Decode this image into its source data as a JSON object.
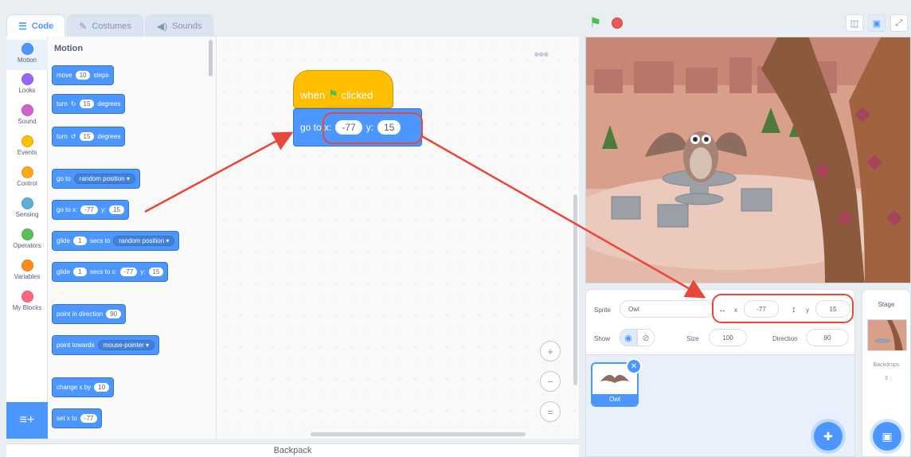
{
  "tabs": [
    {
      "label": "Code",
      "icon": "code-icon",
      "active": true
    },
    {
      "label": "Costumes",
      "icon": "brush-icon",
      "active": false
    },
    {
      "label": "Sounds",
      "icon": "speaker-icon",
      "active": false
    }
  ],
  "categories": [
    {
      "label": "Motion",
      "color": "#4c97ff"
    },
    {
      "label": "Looks",
      "color": "#9966ff"
    },
    {
      "label": "Sound",
      "color": "#cf63cf"
    },
    {
      "label": "Events",
      "color": "#ffbf00"
    },
    {
      "label": "Control",
      "color": "#ffab19"
    },
    {
      "label": "Sensing",
      "color": "#5cb1d6"
    },
    {
      "label": "Operators",
      "color": "#59c059"
    },
    {
      "label": "Variables",
      "color": "#ff8c1a"
    },
    {
      "label": "My Blocks",
      "color": "#ff6680"
    }
  ],
  "palette": {
    "title": "Motion",
    "move": {
      "a": "move",
      "v": "10",
      "b": "steps"
    },
    "turn_cw": {
      "a": "turn",
      "icon": "↻",
      "v": "15",
      "b": "degrees"
    },
    "turn_ccw": {
      "a": "turn",
      "icon": "↺",
      "v": "15",
      "b": "degrees"
    },
    "goto_random": {
      "a": "go to",
      "dd": "random position ▾"
    },
    "goto_xy": {
      "a": "go to x:",
      "x": "-77",
      "b": "y:",
      "y": "15"
    },
    "glide_random": {
      "a": "glide",
      "v": "1",
      "b": "secs to",
      "dd": "random position ▾"
    },
    "glide_xy": {
      "a": "glide",
      "v": "1",
      "b": "secs to x:",
      "x": "-77",
      "c": "y:",
      "y": "15"
    },
    "point_dir": {
      "a": "point in direction",
      "v": "90"
    },
    "point_towards": {
      "a": "point towards",
      "dd": "mouse-pointer ▾"
    },
    "change_x": {
      "a": "change x by",
      "v": "10"
    },
    "set_x": {
      "a": "set x to",
      "v": "-77"
    }
  },
  "script": {
    "hat_when": "when",
    "hat_clicked": "clicked",
    "goto_label": "go to x:",
    "x": "-77",
    "y_label": "y:",
    "y": "15"
  },
  "zoom": {
    "in": "+",
    "out": "−",
    "reset": "="
  },
  "backpack": "Backpack",
  "sprite_info": {
    "sprite_label": "Sprite",
    "sprite_name": "Owl",
    "x_label": "x",
    "x": "-77",
    "y_label": "y",
    "y": "15",
    "show_label": "Show",
    "size_label": "Size",
    "size": "100",
    "direction_label": "Direction",
    "direction": "90"
  },
  "sprites": [
    {
      "name": "Owl"
    }
  ],
  "stage_panel": {
    "title": "Stage",
    "backdrops_label": "Backdrops",
    "backdrops_count": "3"
  },
  "colors": {
    "motion": "#4c97ff",
    "events": "#ffbf00",
    "highlight": "#e8483a",
    "green_flag": "#4cbf56",
    "stop": "#ec5959"
  }
}
